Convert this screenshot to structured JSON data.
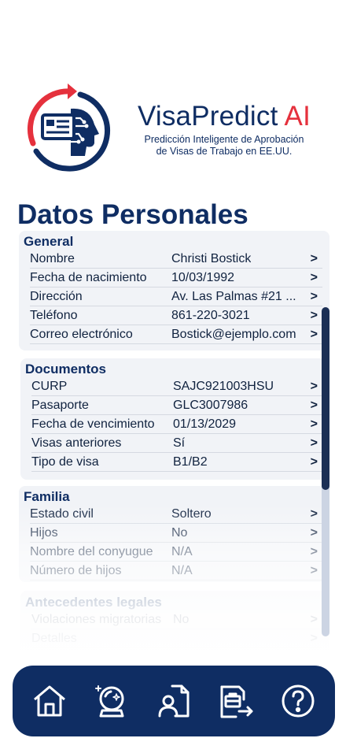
{
  "brand": {
    "name_part1": "VisaPredict",
    "name_part2": "AI",
    "tagline_line1": "Predicción Inteligente de Aprobación",
    "tagline_line2": "de Visas de Trabajo en EE.UU.",
    "colors": {
      "navy": "#0f2d63",
      "red": "#e5313d"
    }
  },
  "page_title": "Datos Personales",
  "sections": {
    "general": {
      "title": "General",
      "rows": [
        {
          "label": "Nombre",
          "value": "Christi Bostick"
        },
        {
          "label": "Fecha de nacimiento",
          "value": "10/03/1992"
        },
        {
          "label": "Dirección",
          "value": "Av. Las Palmas #21 ..."
        },
        {
          "label": "Teléfono",
          "value": "861-220-3021"
        },
        {
          "label": "Correo electrónico",
          "value": "Bostick@ejemplo.com"
        }
      ]
    },
    "documentos": {
      "title": "Documentos",
      "rows": [
        {
          "label": "CURP",
          "value": "SAJC921003HSU"
        },
        {
          "label": "Pasaporte",
          "value": "GLC3007986"
        },
        {
          "label": "Fecha de vencimiento",
          "value": "01/13/2029"
        },
        {
          "label": "Visas anteriores",
          "value": "Sí"
        },
        {
          "label": "Tipo de visa",
          "value": "B1/B2"
        }
      ]
    },
    "familia": {
      "title": "Familia",
      "rows": [
        {
          "label": "Estado civil",
          "value": "Soltero"
        },
        {
          "label": "Hijos",
          "value": "No"
        },
        {
          "label": "Nombre del conyugue",
          "value": "N/A"
        },
        {
          "label": "Número de hijos",
          "value": "N/A"
        }
      ]
    },
    "antecedentes": {
      "title": "Antecedentes legales",
      "rows": [
        {
          "label": "Violaciones migratorias",
          "value": "No"
        },
        {
          "label": "Detalles",
          "value": ""
        }
      ]
    }
  },
  "chevron": ">",
  "nav": [
    {
      "icon": "home-icon"
    },
    {
      "icon": "crystal-ball-icon"
    },
    {
      "icon": "user-document-icon"
    },
    {
      "icon": "briefcase-export-icon"
    },
    {
      "icon": "help-icon"
    }
  ]
}
